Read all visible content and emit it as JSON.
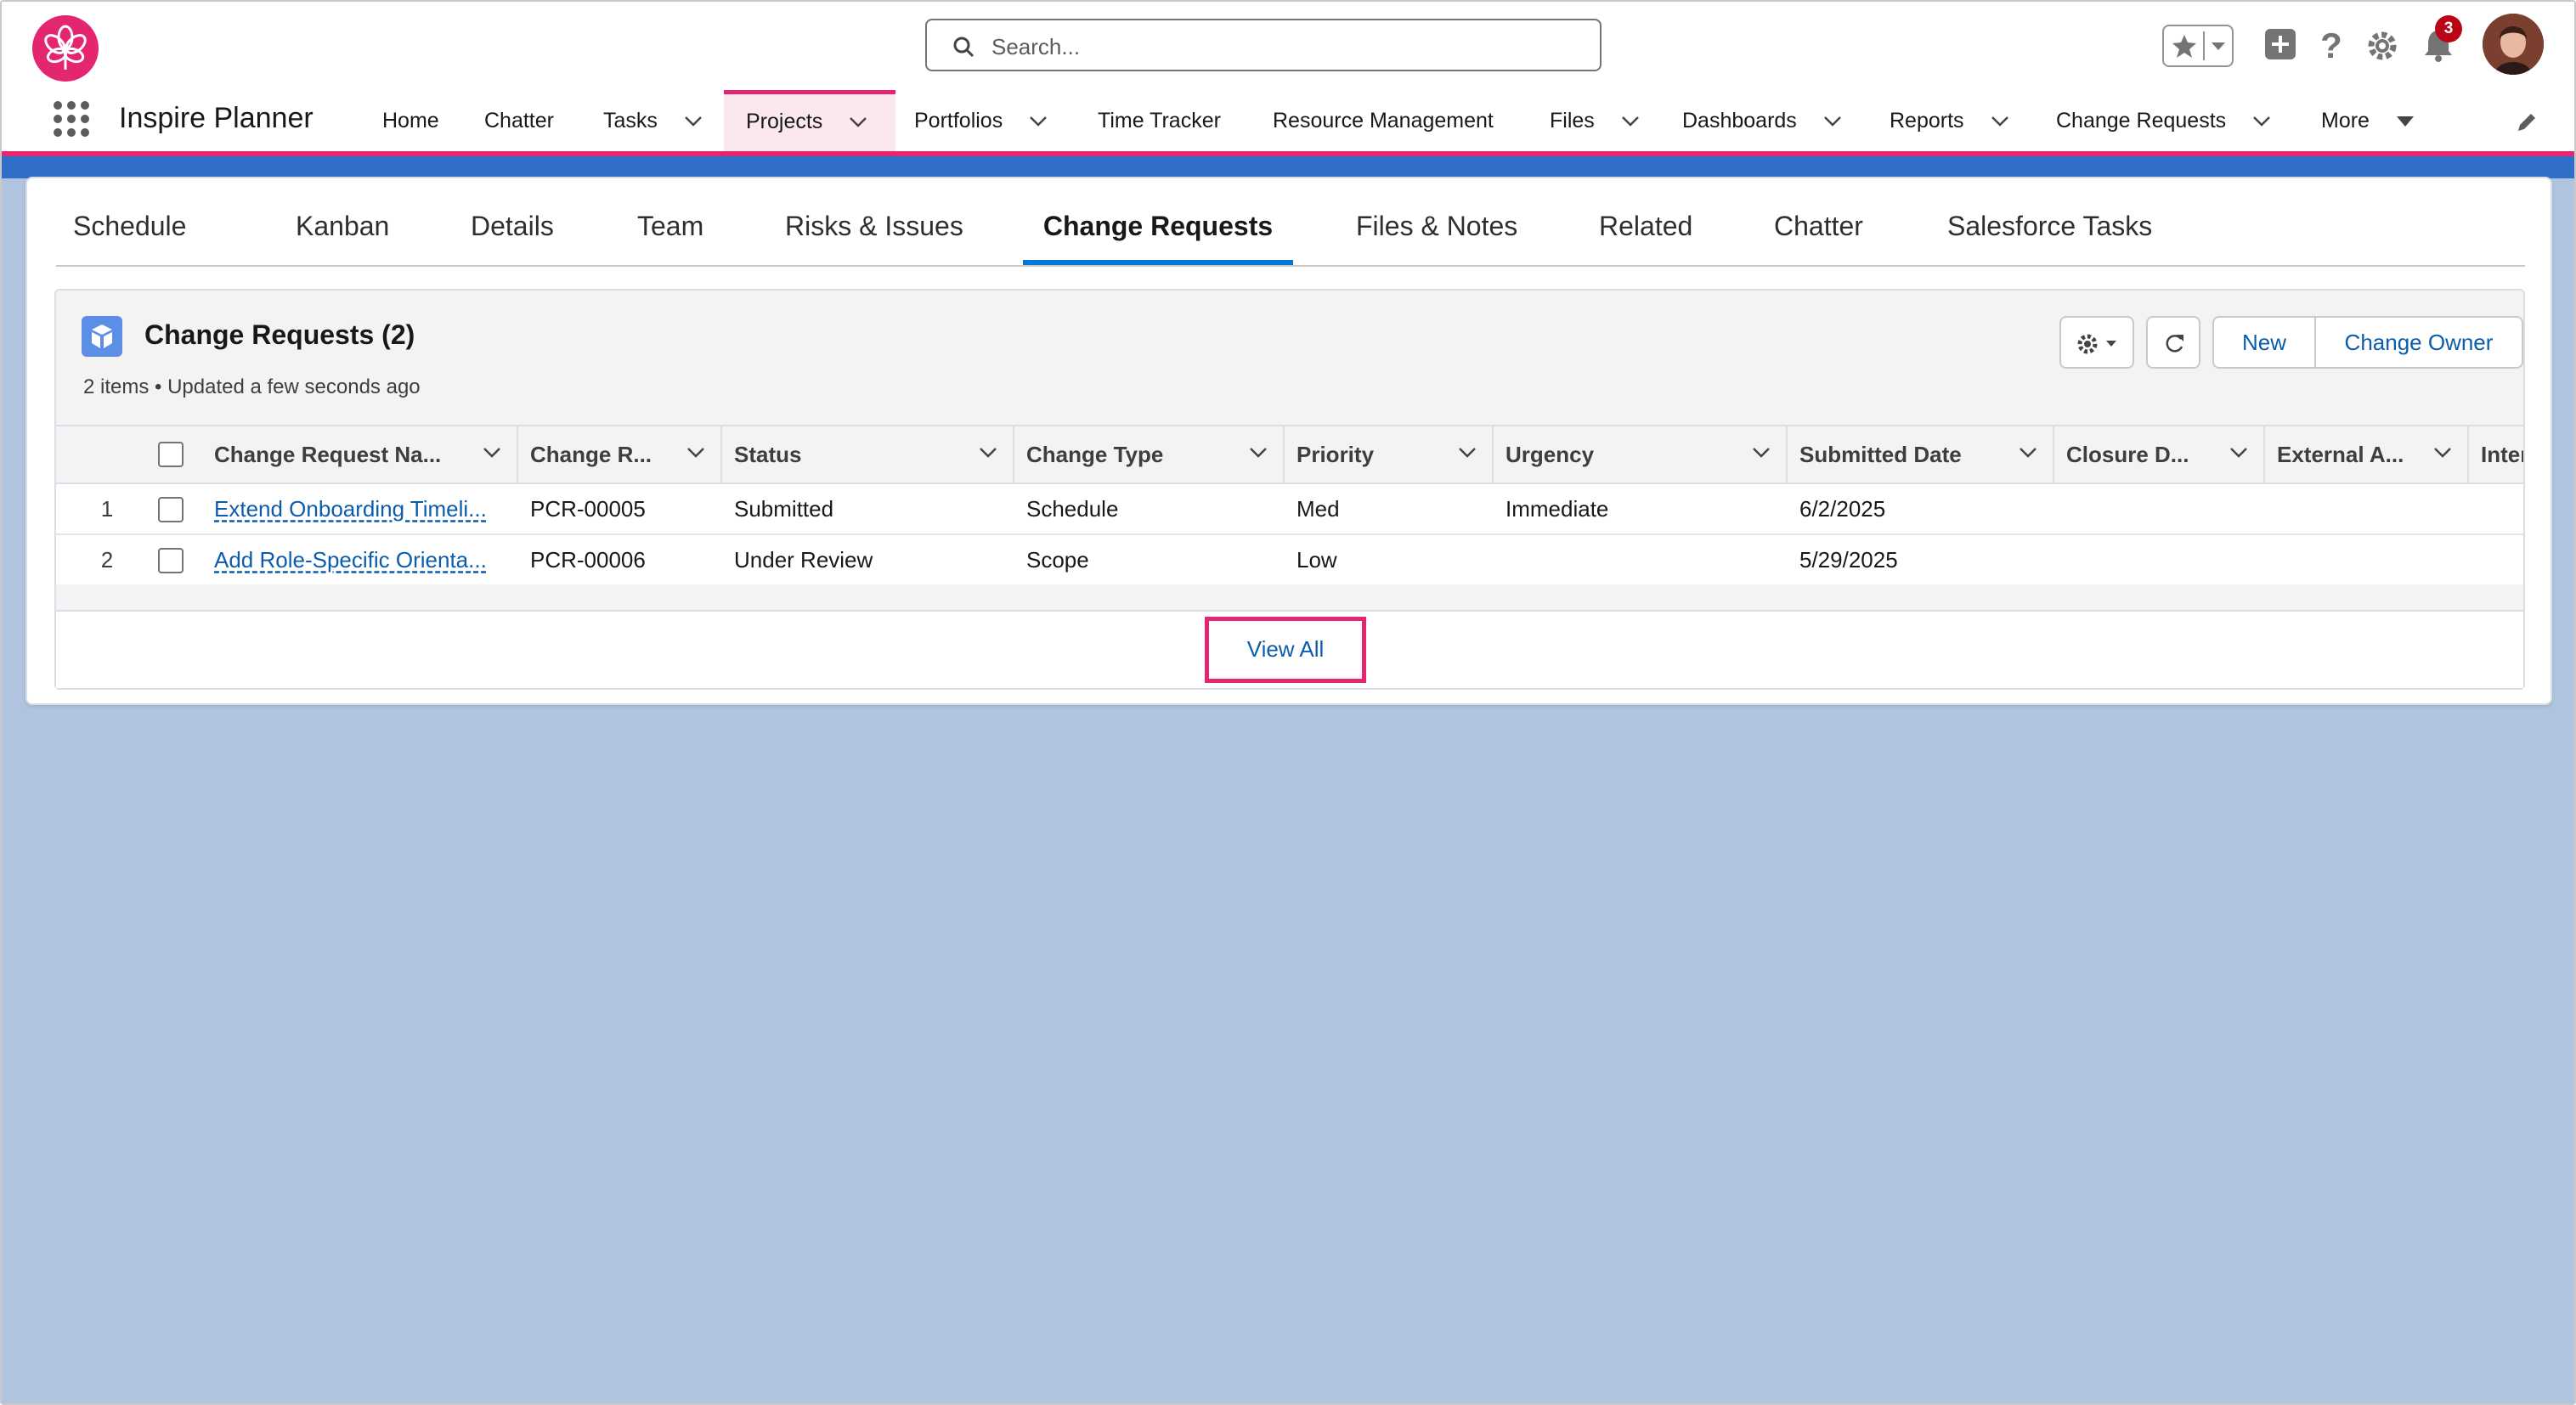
{
  "header": {
    "search_placeholder": "Search...",
    "notification_count": "3",
    "app_name": "Inspire Planner",
    "nav": [
      {
        "label": "Home"
      },
      {
        "label": "Chatter"
      },
      {
        "label": "Tasks"
      },
      {
        "label": "Projects"
      },
      {
        "label": "Portfolios"
      },
      {
        "label": "Time Tracker"
      },
      {
        "label": "Resource Management"
      },
      {
        "label": "Files"
      },
      {
        "label": "Dashboards"
      },
      {
        "label": "Reports"
      },
      {
        "label": "Change Requests"
      },
      {
        "label": "More"
      }
    ],
    "active_nav": "Projects"
  },
  "tabs": [
    {
      "label": "Schedule"
    },
    {
      "label": "Kanban"
    },
    {
      "label": "Details"
    },
    {
      "label": "Team"
    },
    {
      "label": "Risks & Issues"
    },
    {
      "label": "Change Requests"
    },
    {
      "label": "Files & Notes"
    },
    {
      "label": "Related"
    },
    {
      "label": "Chatter"
    },
    {
      "label": "Salesforce Tasks"
    }
  ],
  "active_tab": "Change Requests",
  "related_list": {
    "title": "Change Requests (2)",
    "subtitle": "2 items • Updated a few seconds ago",
    "buttons": {
      "new": "New",
      "change_owner": "Change Owner"
    },
    "columns": [
      "Change Request Na...",
      "Change R...",
      "Status",
      "Change Type",
      "Priority",
      "Urgency",
      "Submitted Date",
      "Closure D...",
      "External A...",
      "Intern"
    ],
    "rows": [
      {
        "num": "1",
        "name": "Extend Onboarding Timeli...",
        "id": "PCR-00005",
        "status": "Submitted",
        "type": "Schedule",
        "priority": "Med",
        "urgency": "Immediate",
        "submitted": "6/2/2025"
      },
      {
        "num": "2",
        "name": "Add Role-Specific Orienta...",
        "id": "PCR-00006",
        "status": "Under Review",
        "type": "Scope",
        "priority": "Low",
        "urgency": "",
        "submitted": "5/29/2025"
      }
    ],
    "view_all": "View All"
  },
  "colors": {
    "brand": "#e3266f",
    "link": "#0b5cab",
    "background": "#b0c4df"
  }
}
